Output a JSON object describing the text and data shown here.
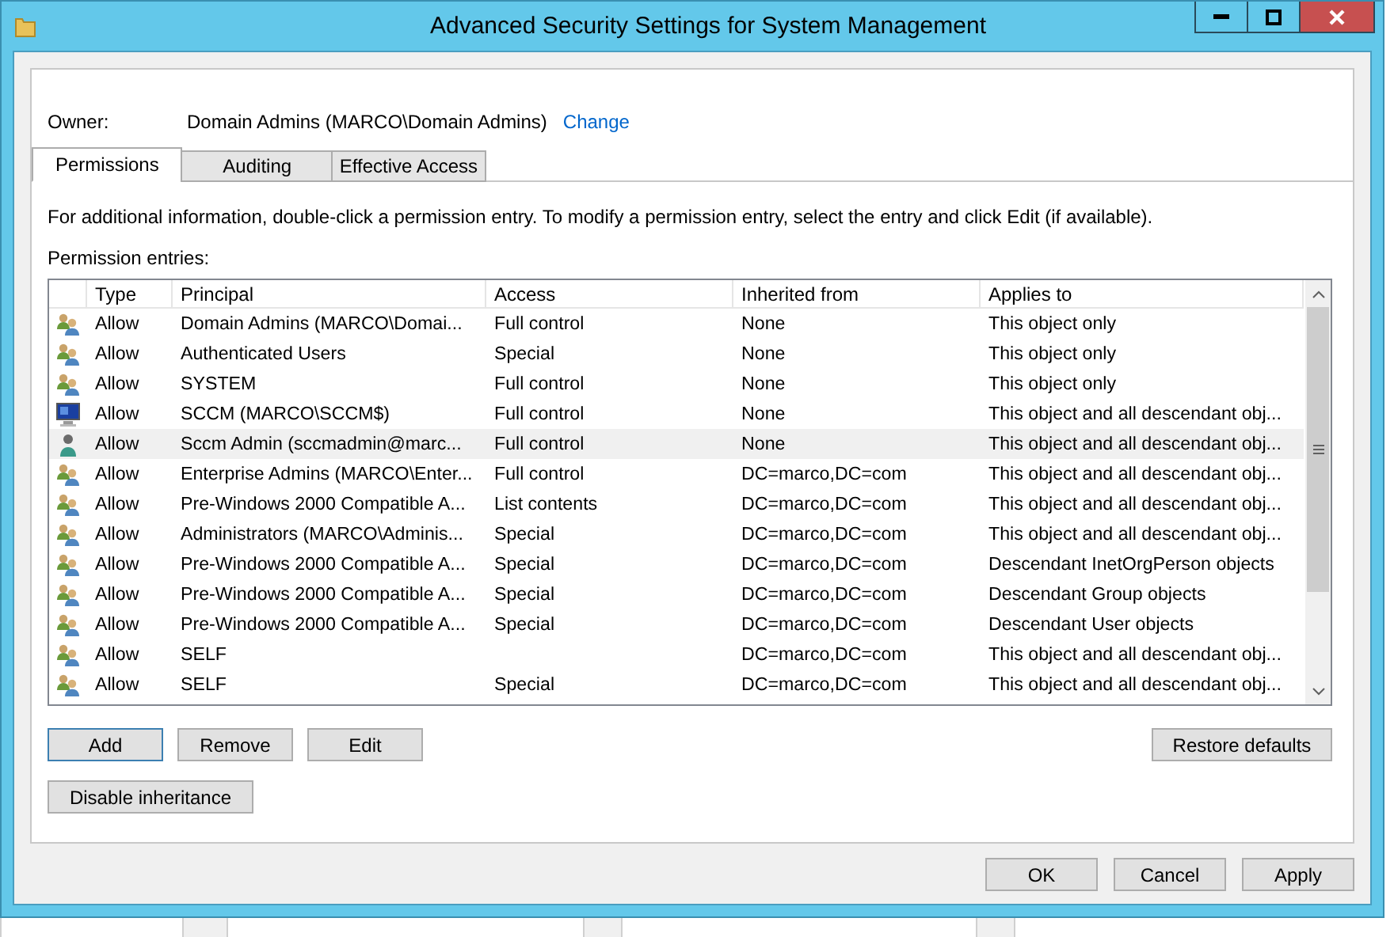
{
  "window": {
    "title": "Advanced Security Settings for System Management"
  },
  "owner": {
    "label": "Owner:",
    "value": "Domain Admins (MARCO\\Domain Admins)",
    "link": "Change"
  },
  "tabs": [
    {
      "label": "Permissions",
      "selected": true
    },
    {
      "label": "Auditing",
      "selected": false
    },
    {
      "label": "Effective Access",
      "selected": false
    }
  ],
  "info": "For additional information, double-click a permission entry. To modify a permission entry, select the entry and click Edit (if available).",
  "entries_label": "Permission entries:",
  "table": {
    "columns": [
      "Type",
      "Principal",
      "Access",
      "Inherited from",
      "Applies to"
    ],
    "rows": [
      {
        "kind": "group",
        "selected": false,
        "cells": [
          "Allow",
          "Domain Admins (MARCO\\Domai...",
          "Full control",
          "None",
          "This object only"
        ]
      },
      {
        "kind": "group",
        "selected": false,
        "cells": [
          "Allow",
          "Authenticated Users",
          "Special",
          "None",
          "This object only"
        ]
      },
      {
        "kind": "group",
        "selected": false,
        "cells": [
          "Allow",
          "SYSTEM",
          "Full control",
          "None",
          "This object only"
        ]
      },
      {
        "kind": "computer",
        "selected": false,
        "cells": [
          "Allow",
          "SCCM (MARCO\\SCCM$)",
          "Full control",
          "None",
          "This object and all descendant obj..."
        ]
      },
      {
        "kind": "user",
        "selected": true,
        "cells": [
          "Allow",
          "Sccm Admin (sccmadmin@marc...",
          "Full control",
          "None",
          "This object and all descendant obj..."
        ]
      },
      {
        "kind": "group",
        "selected": false,
        "cells": [
          "Allow",
          "Enterprise Admins (MARCO\\Enter...",
          "Full control",
          "DC=marco,DC=com",
          "This object and all descendant obj..."
        ]
      },
      {
        "kind": "group",
        "selected": false,
        "cells": [
          "Allow",
          "Pre-Windows 2000 Compatible A...",
          "List contents",
          "DC=marco,DC=com",
          "This object and all descendant obj..."
        ]
      },
      {
        "kind": "group",
        "selected": false,
        "cells": [
          "Allow",
          "Administrators (MARCO\\Adminis...",
          "Special",
          "DC=marco,DC=com",
          "This object and all descendant obj..."
        ]
      },
      {
        "kind": "group",
        "selected": false,
        "cells": [
          "Allow",
          "Pre-Windows 2000 Compatible A...",
          "Special",
          "DC=marco,DC=com",
          "Descendant InetOrgPerson objects"
        ]
      },
      {
        "kind": "group",
        "selected": false,
        "cells": [
          "Allow",
          "Pre-Windows 2000 Compatible A...",
          "Special",
          "DC=marco,DC=com",
          "Descendant Group objects"
        ]
      },
      {
        "kind": "group",
        "selected": false,
        "cells": [
          "Allow",
          "Pre-Windows 2000 Compatible A...",
          "Special",
          "DC=marco,DC=com",
          "Descendant User objects"
        ]
      },
      {
        "kind": "group",
        "selected": false,
        "cells": [
          "Allow",
          "SELF",
          "",
          "DC=marco,DC=com",
          "This object and all descendant obj..."
        ]
      },
      {
        "kind": "group",
        "selected": false,
        "cells": [
          "Allow",
          "SELF",
          "Special",
          "DC=marco,DC=com",
          "This object and all descendant obj..."
        ]
      }
    ]
  },
  "entry_buttons": [
    {
      "label": "Add",
      "default": true
    },
    {
      "label": "Remove",
      "default": false
    },
    {
      "label": "Edit",
      "default": false
    }
  ],
  "restore_button": "Restore defaults",
  "inheritance_button": "Disable inheritance",
  "dialog_buttons": [
    "OK",
    "Cancel",
    "Apply"
  ]
}
